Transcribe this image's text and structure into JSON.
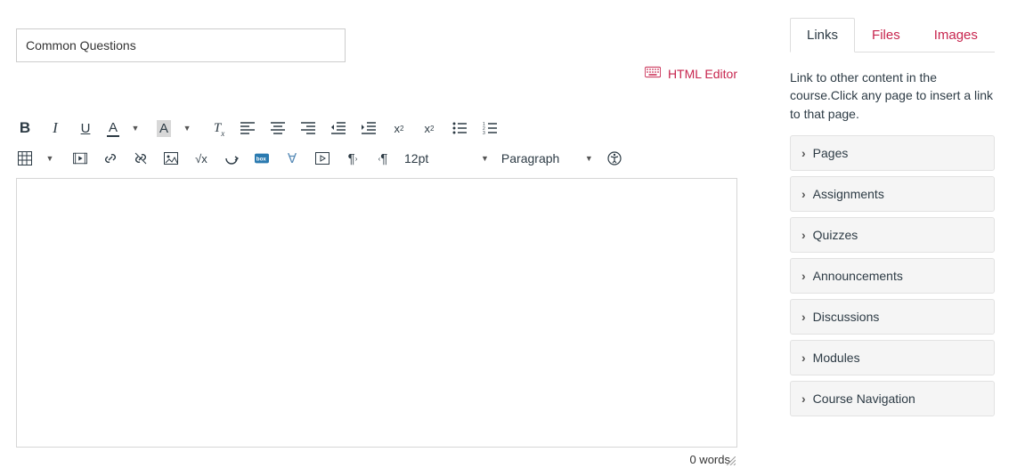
{
  "title_input": {
    "value": "Common Questions"
  },
  "html_editor_label": "HTML Editor",
  "font_size": "12pt",
  "paragraph": "Paragraph",
  "word_count": "0 words",
  "sidebar": {
    "tabs": [
      "Links",
      "Files",
      "Images"
    ],
    "active_tab": 0,
    "description": "Link to other content in the course.Click any page to insert a link to that page.",
    "accordion": [
      "Pages",
      "Assignments",
      "Quizzes",
      "Announcements",
      "Discussions",
      "Modules",
      "Course Navigation"
    ]
  }
}
